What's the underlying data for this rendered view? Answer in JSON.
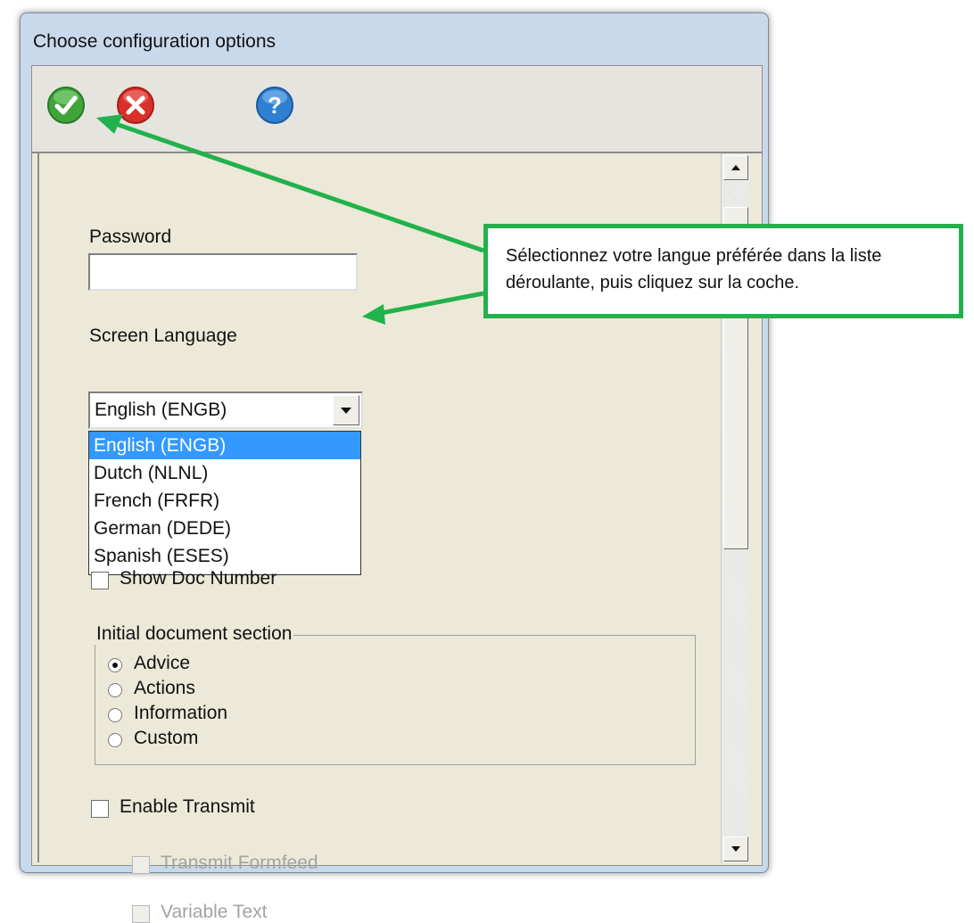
{
  "window": {
    "title": "Choose configuration options"
  },
  "toolbar": {
    "ok": {
      "icon": "checkmark-icon",
      "color": "#3fa43a"
    },
    "cancel": {
      "icon": "close-icon",
      "color": "#d9302a"
    },
    "help": {
      "icon": "help-icon",
      "color": "#2f7fd2"
    }
  },
  "form": {
    "password_label": "Password",
    "password_value": "",
    "language_label": "Screen Language",
    "language_selected": "English (ENGB)",
    "language_options": [
      "English (ENGB)",
      "Dutch (NLNL)",
      "French (FRFR)",
      "German (DEDE)",
      "Spanish (ESES)"
    ],
    "show_doc_number_label": "Show Doc Number",
    "show_doc_number_checked": false,
    "initial_section_label": "Initial document section",
    "sections": [
      {
        "label": "Advice",
        "checked": true
      },
      {
        "label": "Actions",
        "checked": false
      },
      {
        "label": "Information",
        "checked": false
      },
      {
        "label": "Custom",
        "checked": false
      }
    ],
    "enable_transmit_label": "Enable Transmit",
    "enable_transmit_checked": false,
    "transmit_formfeed_label": "Transmit Formfeed",
    "variable_text_label": "Variable Text"
  },
  "annotation": {
    "text": "Sélectionnez votre langue préférée dans la liste déroulante, puis cliquez sur la coche.",
    "color": "#22b14c"
  }
}
